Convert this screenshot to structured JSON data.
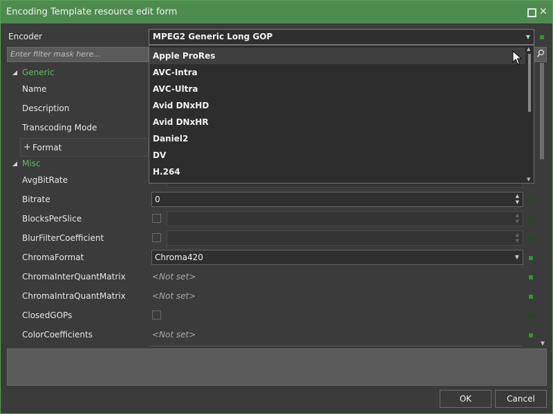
{
  "window": {
    "title": "Encoding Template resource edit form"
  },
  "encoder": {
    "label": "Encoder",
    "value": "MPEG2 Generic Long GOP"
  },
  "filter": {
    "placeholder": "Enter filter mask here..."
  },
  "dropdown": {
    "items": [
      "Apple ProRes",
      "AVC-Intra",
      "AVC-Ultra",
      "Avid DNxHD",
      "Avid DNxHR",
      "Daniel2",
      "DV",
      "H.264"
    ],
    "hovered_index": 0
  },
  "groups": {
    "generic": {
      "label": "Generic",
      "rows": [
        "Name",
        "Description",
        "Transcoding Mode"
      ],
      "format_label": "Format"
    },
    "misc": {
      "label": "Misc",
      "rows": {
        "avg_bitrate": "AvgBitRate",
        "bitrate": "Bitrate",
        "bitrate_value": "0",
        "blocks_per_slice": "BlocksPerSlice",
        "blur_filter": "BlurFilterCoefficient",
        "chroma_format": "ChromaFormat",
        "chroma_format_value": "Chroma420",
        "chroma_inter": "ChromaInterQuantMatrix",
        "chroma_intra": "ChromaIntraQuantMatrix",
        "closed_gops": "ClosedGOPs",
        "color_coeff": "ColorCoefficients",
        "not_set": "<Not set>"
      }
    }
  },
  "buttons": {
    "ok": "OK",
    "cancel": "Cancel"
  },
  "icons": {
    "maximize": "maximize-icon",
    "close": "close-icon",
    "search": "search-icon",
    "collapse": "collapse-triangle-icon",
    "expand": "plus-icon",
    "dropdown": "chevron-down-icon"
  },
  "colors": {
    "titlebar": "#4e8b4e",
    "accent_green": "#5fbb5f",
    "indicator": "#2a9a2a",
    "background": "#3b3b3b"
  }
}
